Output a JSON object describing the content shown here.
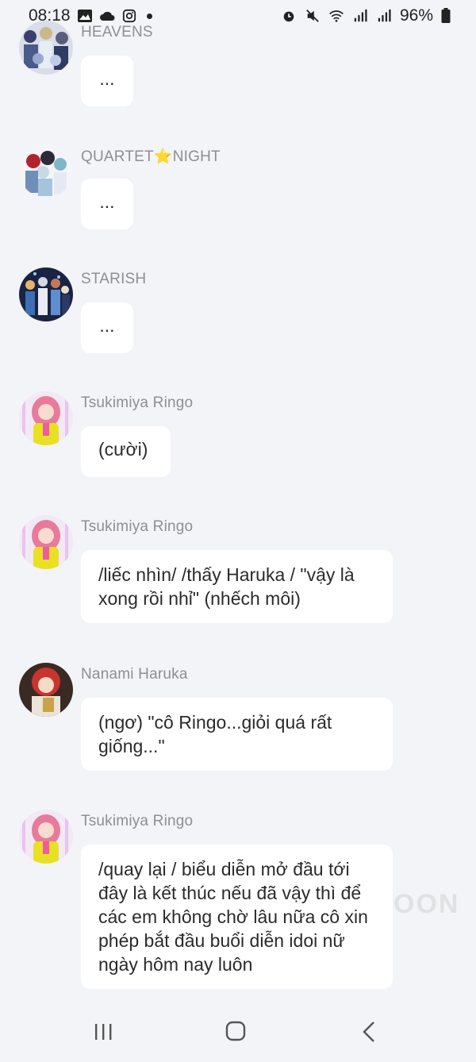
{
  "status_bar": {
    "time": "08:18",
    "battery": "96%",
    "left_icons": [
      "image-icon",
      "cloud-icon",
      "instagram-icon",
      "notification-dot"
    ],
    "right_icons": [
      "alarm-icon",
      "mute-icon",
      "wifi-icon",
      "signal-icon",
      "signal-icon",
      "battery-icon"
    ]
  },
  "messages": [
    {
      "sender": "HEAVENS",
      "text": "..."
    },
    {
      "sender": "QUARTET⭐NIGHT",
      "text": "..."
    },
    {
      "sender": "STARISH",
      "text": "..."
    },
    {
      "sender": "Tsukimiya Ringo",
      "text": "(cười)"
    },
    {
      "sender": "Tsukimiya Ringo",
      "text": "/liếc nhìn/ /thấy Haruka / \"vậy là xong rồi nhỉ\" (nhếch môi)"
    },
    {
      "sender": "Nanami Haruka",
      "text": "(ngơ) \"cô Ringo...giỏi quá rất giống...\""
    },
    {
      "sender": "Tsukimiya Ringo",
      "text": "/quay lại / biểu diễn mở đầu tới đây là kết thúc nếu đã vậy thì để các em không chờ lâu nữa cô xin phép bắt đầu buổi diễn idoi nữ ngày hôm nay luôn"
    }
  ],
  "watermark": "OON",
  "nav": [
    "recent-apps-icon",
    "home-icon",
    "back-icon"
  ]
}
